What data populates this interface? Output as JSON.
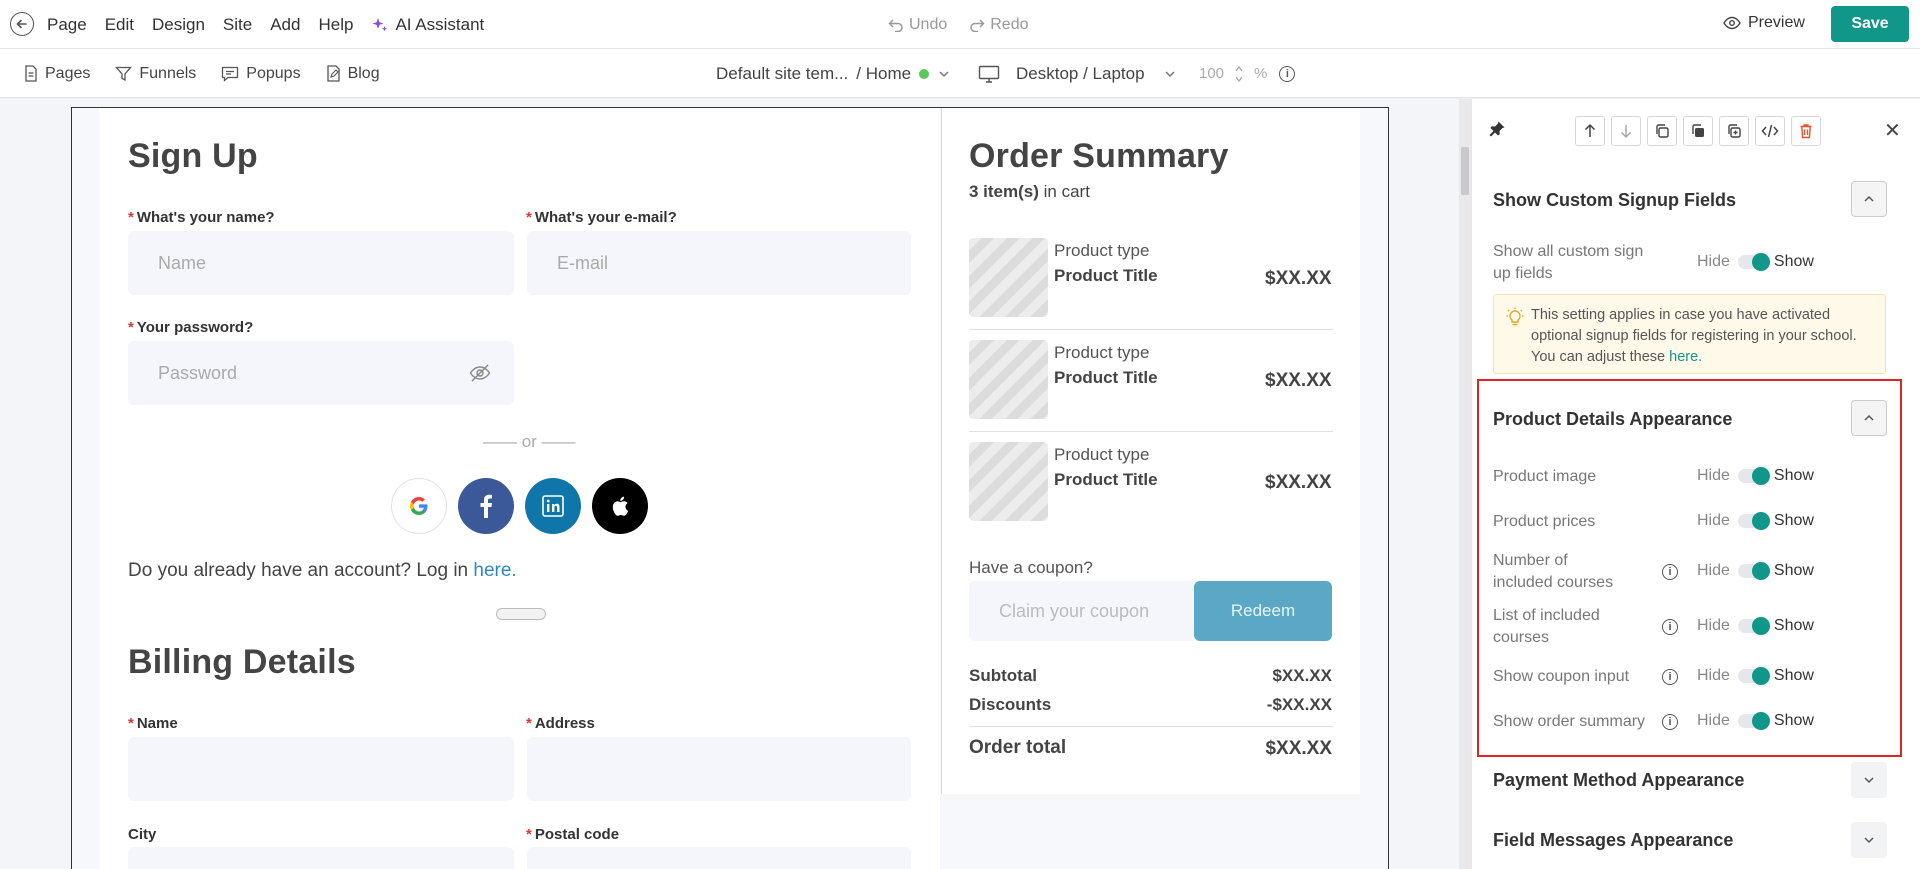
{
  "topbar": {
    "menu": [
      "Page",
      "Edit",
      "Design",
      "Site",
      "Add",
      "Help"
    ],
    "ai_label": "AI Assistant",
    "undo_label": "Undo",
    "redo_label": "Redo",
    "preview_label": "Preview",
    "save_label": "Save"
  },
  "toolbar2": {
    "nav": [
      "Pages",
      "Funnels",
      "Popups",
      "Blog"
    ],
    "site_template": "Default site tem...",
    "site_page": "/ Home",
    "device": "Desktop / Laptop",
    "zoom": "100",
    "zoom_unit": "%"
  },
  "signup": {
    "title": "Sign Up",
    "name_label": "What's your name?",
    "name_placeholder": "Name",
    "email_label": "What's your e-mail?",
    "email_placeholder": "E-mail",
    "password_label": "Your password?",
    "password_placeholder": "Password",
    "or_text": "—— or ——",
    "login_prefix": "Do you already have an account? Log in ",
    "login_link": "here."
  },
  "billing": {
    "title": "Billing Details",
    "name_label": "Name",
    "address_label": "Address",
    "city_label": "City",
    "postal_label": "Postal code"
  },
  "order": {
    "title": "Order Summary",
    "count_bold": "3 item(s)",
    "count_rest": " in cart",
    "items": [
      {
        "type": "Product type",
        "title": "Product Title",
        "price": "$XX.XX"
      },
      {
        "type": "Product type",
        "title": "Product Title",
        "price": "$XX.XX"
      },
      {
        "type": "Product type",
        "title": "Product Title",
        "price": "$XX.XX"
      }
    ],
    "coupon_question": "Have a coupon?",
    "coupon_placeholder": "Claim your coupon",
    "redeem_label": "Redeem",
    "subtotal_label": "Subtotal",
    "subtotal_value": "$XX.XX",
    "discounts_label": "Discounts",
    "discounts_value": "-$XX.XX",
    "total_label": "Order total",
    "total_value": "$XX.XX"
  },
  "panel": {
    "custom_signup": {
      "title": "Show Custom Signup Fields",
      "setting_label": "Show all custom sign up fields",
      "note_text": "This setting applies in case you have activated optional signup fields for registering in your school. You can adjust these ",
      "note_link": "here."
    },
    "product_details": {
      "title": "Product Details Appearance",
      "rows": [
        {
          "label": "Product image",
          "info": false
        },
        {
          "label": "Product prices",
          "info": false
        },
        {
          "label": "Number of included courses",
          "info": true
        },
        {
          "label": "List of included courses",
          "info": true
        },
        {
          "label": "Show coupon input",
          "info": true
        },
        {
          "label": "Show order summary",
          "info": true
        }
      ]
    },
    "payment_title": "Payment Method Appearance",
    "field_messages_title": "Field Messages Appearance",
    "hide_label": "Hide",
    "show_label": "Show"
  },
  "colors": {
    "accent": "#11968a",
    "ai": "#8b4ad8",
    "highlight": "#e02424",
    "link": "#2e86c9"
  }
}
